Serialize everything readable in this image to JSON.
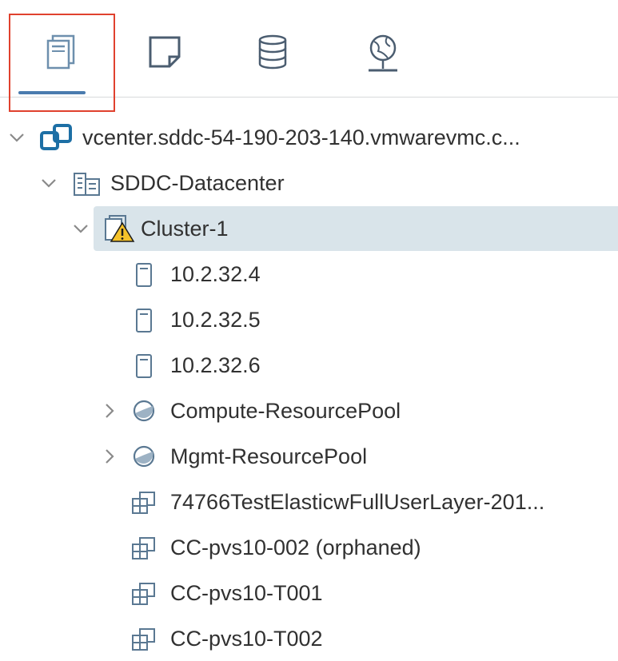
{
  "tabs": [
    {
      "name": "hosts-and-clusters",
      "icon": "hosts-clusters-icon",
      "active": true
    },
    {
      "name": "vms-and-templates",
      "icon": "vm-template-icon",
      "active": false
    },
    {
      "name": "storage",
      "icon": "storage-icon",
      "active": false
    },
    {
      "name": "networking",
      "icon": "network-icon",
      "active": false
    }
  ],
  "tree": {
    "vcenter": "vcenter.sddc-54-190-203-140.vmwarevmc.c...",
    "datacenter": "SDDC-Datacenter",
    "cluster": "Cluster-1",
    "hosts": [
      "10.2.32.4",
      "10.2.32.5",
      "10.2.32.6"
    ],
    "resource_pools": [
      "Compute-ResourcePool",
      "Mgmt-ResourcePool"
    ],
    "vms": [
      "74766TestElasticwFullUserLayer-201...",
      "CC-pvs10-002 (orphaned)",
      "CC-pvs10-T001",
      "CC-pvs10-T002"
    ]
  },
  "colors": {
    "accent": "#4a7bae",
    "highlight_box": "#e0412e",
    "selection": "#d9e4ea",
    "vcenter_icon": "#1d6fa5",
    "warning": "#f5c22a"
  }
}
